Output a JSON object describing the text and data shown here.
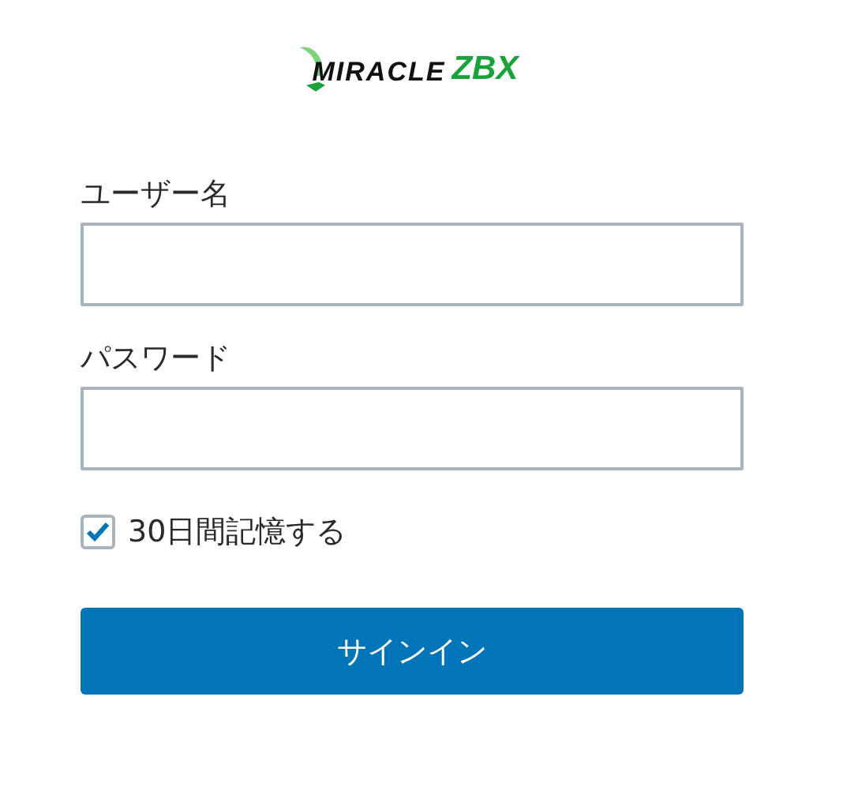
{
  "logo": {
    "brand": "MIRACLE",
    "product": "ZBX"
  },
  "fields": [
    {
      "label": "ユーザー名"
    },
    {
      "label": "パスワード"
    }
  ],
  "remember": {
    "label": "30日間記憶する",
    "checked": true
  },
  "button": {
    "label": "サインイン"
  }
}
